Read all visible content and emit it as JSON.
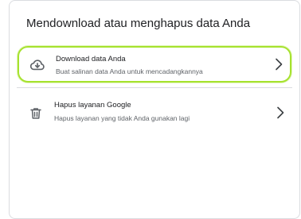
{
  "card": {
    "title": "Mendownload atau menghapus data Anda"
  },
  "items": [
    {
      "title": "Download data Anda",
      "description": "Buat salinan data Anda untuk mencadangkannya",
      "icon": "cloud-download-icon"
    },
    {
      "title": "Hapus layanan Google",
      "description": "Hapus layanan yang tidak Anda gunakan lagi",
      "icon": "trash-icon"
    }
  ],
  "colors": {
    "highlight": "#a6e22e",
    "text_primary": "#202124",
    "text_secondary": "#5f6368",
    "icon": "#5f6368",
    "border": "#dadce0"
  }
}
